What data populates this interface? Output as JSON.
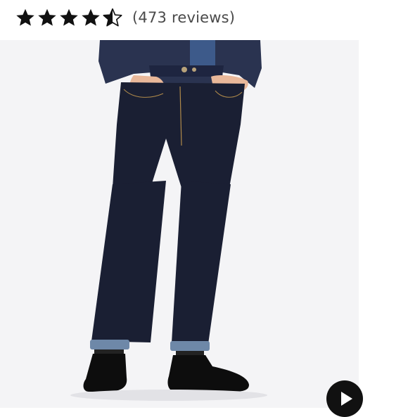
{
  "rating": {
    "value": 4.5,
    "max": 5,
    "review_count_text": "(473 reviews)",
    "star_color": "#111111"
  },
  "product_image": {
    "background": "#f4f4f6",
    "denim_color": "#1a1f33",
    "jacket_color": "#2a3350"
  },
  "video": {
    "icon": "play-icon"
  }
}
